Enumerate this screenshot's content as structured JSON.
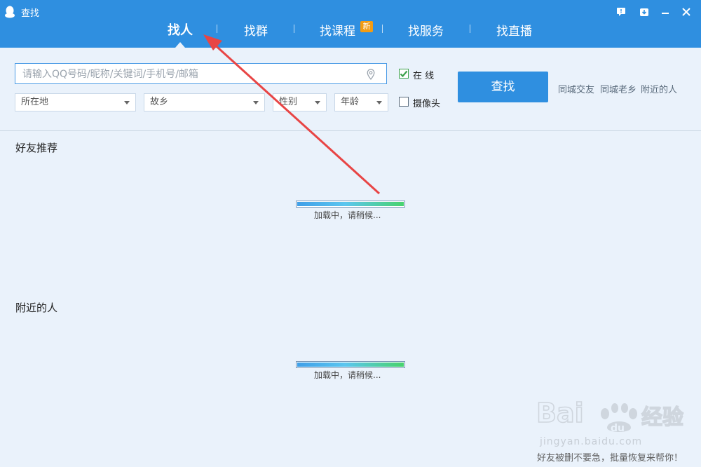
{
  "window": {
    "title": "查找"
  },
  "tabs": [
    {
      "label": "找人",
      "active": true
    },
    {
      "label": "找群"
    },
    {
      "label": "找课程",
      "badge": "新"
    },
    {
      "label": "找服务"
    },
    {
      "label": "找直播"
    }
  ],
  "window_controls": [
    {
      "name": "feedback-icon",
      "glyph": "💬"
    },
    {
      "name": "minimize-to-tray-icon",
      "glyph": "⇩"
    },
    {
      "name": "minimize-icon",
      "glyph": "—"
    },
    {
      "name": "close-icon",
      "glyph": "✕"
    }
  ],
  "search": {
    "placeholder": "请输入QQ号码/昵称/关键词/手机号/邮箱",
    "value": ""
  },
  "filters": [
    {
      "label": "所在地"
    },
    {
      "label": "故乡"
    },
    {
      "label": "性别"
    },
    {
      "label": "年龄"
    }
  ],
  "options": {
    "online": {
      "label": "在  线",
      "checked": true
    },
    "camera": {
      "label": "摄像头",
      "checked": false
    }
  },
  "search_button": {
    "label": "查找"
  },
  "quick_links": [
    "同城交友",
    "同城老乡",
    "附近的人"
  ],
  "sections": [
    {
      "title": "好友推荐",
      "loading_text": "加载中，请稍候...",
      "progress": 1.0
    },
    {
      "title": "附近的人",
      "loading_text": "加载中，请稍候...",
      "progress": 1.0
    }
  ],
  "watermark": {
    "logo": "Bai du 经验",
    "site": "jingyan.baidu.com"
  },
  "footer": {
    "text": "好友被删不要急，批量恢复来帮你！"
  },
  "colors": {
    "accent": "#2f8fe0",
    "background": "#eaf2fb",
    "badge": "#f39c12",
    "arrow": "#e84545",
    "check": "#3aa04a"
  }
}
